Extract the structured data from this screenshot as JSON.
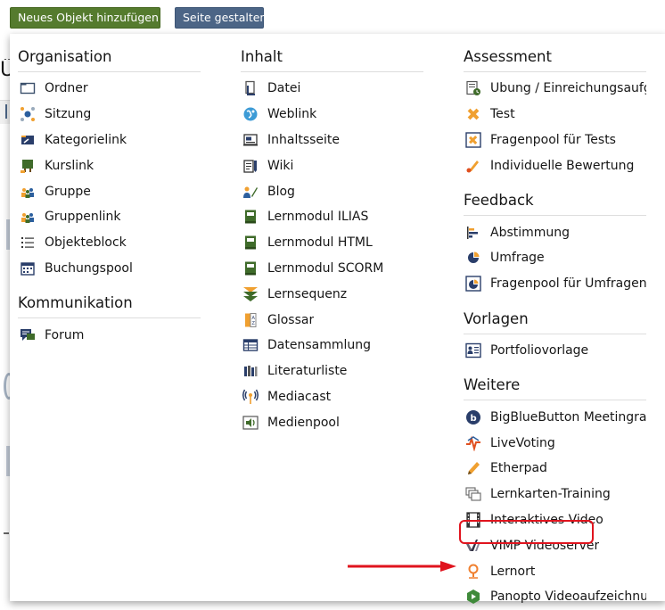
{
  "toolbar": {
    "add_label": "Neues Objekt hinzufügen",
    "page_label": "Seite gestalten"
  },
  "background": {
    "title_fragment": "Ü"
  },
  "menu": {
    "organisation": {
      "title": "Organisation",
      "items": [
        {
          "label": "Ordner",
          "icon": "folder-icon"
        },
        {
          "label": "Sitzung",
          "icon": "session-icon"
        },
        {
          "label": "Kategorielink",
          "icon": "category-link-icon"
        },
        {
          "label": "Kurslink",
          "icon": "course-link-icon"
        },
        {
          "label": "Gruppe",
          "icon": "group-icon"
        },
        {
          "label": "Gruppenlink",
          "icon": "group-link-icon"
        },
        {
          "label": "Objekteblock",
          "icon": "item-group-icon"
        },
        {
          "label": "Buchungspool",
          "icon": "booking-pool-icon"
        }
      ]
    },
    "kommunikation": {
      "title": "Kommunikation",
      "items": [
        {
          "label": "Forum",
          "icon": "forum-icon"
        }
      ]
    },
    "inhalt": {
      "title": "Inhalt",
      "items": [
        {
          "label": "Datei",
          "icon": "file-icon"
        },
        {
          "label": "Weblink",
          "icon": "weblink-icon"
        },
        {
          "label": "Inhaltsseite",
          "icon": "content-page-icon"
        },
        {
          "label": "Wiki",
          "icon": "wiki-icon"
        },
        {
          "label": "Blog",
          "icon": "blog-icon"
        },
        {
          "label": "Lernmodul ILIAS",
          "icon": "learning-module-icon"
        },
        {
          "label": "Lernmodul HTML",
          "icon": "learning-module-html-icon"
        },
        {
          "label": "Lernmodul SCORM",
          "icon": "learning-module-scorm-icon"
        },
        {
          "label": "Lernsequenz",
          "icon": "learning-sequence-icon"
        },
        {
          "label": "Glossar",
          "icon": "glossary-icon"
        },
        {
          "label": "Datensammlung",
          "icon": "data-collection-icon"
        },
        {
          "label": "Literaturliste",
          "icon": "bibliography-icon"
        },
        {
          "label": "Mediacast",
          "icon": "mediacast-icon"
        },
        {
          "label": "Medienpool",
          "icon": "media-pool-icon"
        }
      ]
    },
    "assessment": {
      "title": "Assessment",
      "items": [
        {
          "label": "Übung / Einreichungsaufgabe",
          "icon": "exercise-icon"
        },
        {
          "label": "Test",
          "icon": "test-icon"
        },
        {
          "label": "Fragenpool für Tests",
          "icon": "question-pool-icon"
        },
        {
          "label": "Individuelle Bewertung",
          "icon": "individual-assessment-icon"
        }
      ]
    },
    "feedback": {
      "title": "Feedback",
      "items": [
        {
          "label": "Abstimmung",
          "icon": "poll-icon"
        },
        {
          "label": "Umfrage",
          "icon": "survey-icon"
        },
        {
          "label": "Fragenpool für Umfragen",
          "icon": "survey-pool-icon"
        }
      ]
    },
    "vorlagen": {
      "title": "Vorlagen",
      "items": [
        {
          "label": "Portfoliovorlage",
          "icon": "portfolio-template-icon"
        }
      ]
    },
    "weitere": {
      "title": "Weitere",
      "items": [
        {
          "label": "BigBlueButton Meetingraum",
          "icon": "bigbluebutton-icon"
        },
        {
          "label": "LiveVoting",
          "icon": "livevoting-icon"
        },
        {
          "label": "Etherpad",
          "icon": "etherpad-icon"
        },
        {
          "label": "Lernkarten-Training",
          "icon": "flashcards-icon"
        },
        {
          "label": "Interaktives Video",
          "icon": "interactive-video-icon"
        },
        {
          "label": "VIMP Videoserver",
          "icon": "vimp-icon"
        },
        {
          "label": "Lernort",
          "icon": "location-icon"
        },
        {
          "label": "Panopto Videoaufzeichnung",
          "icon": "panopto-icon"
        }
      ]
    }
  },
  "colors": {
    "add_button": "#557b2e",
    "page_button": "#4c6586",
    "highlight": "#e0141e"
  }
}
